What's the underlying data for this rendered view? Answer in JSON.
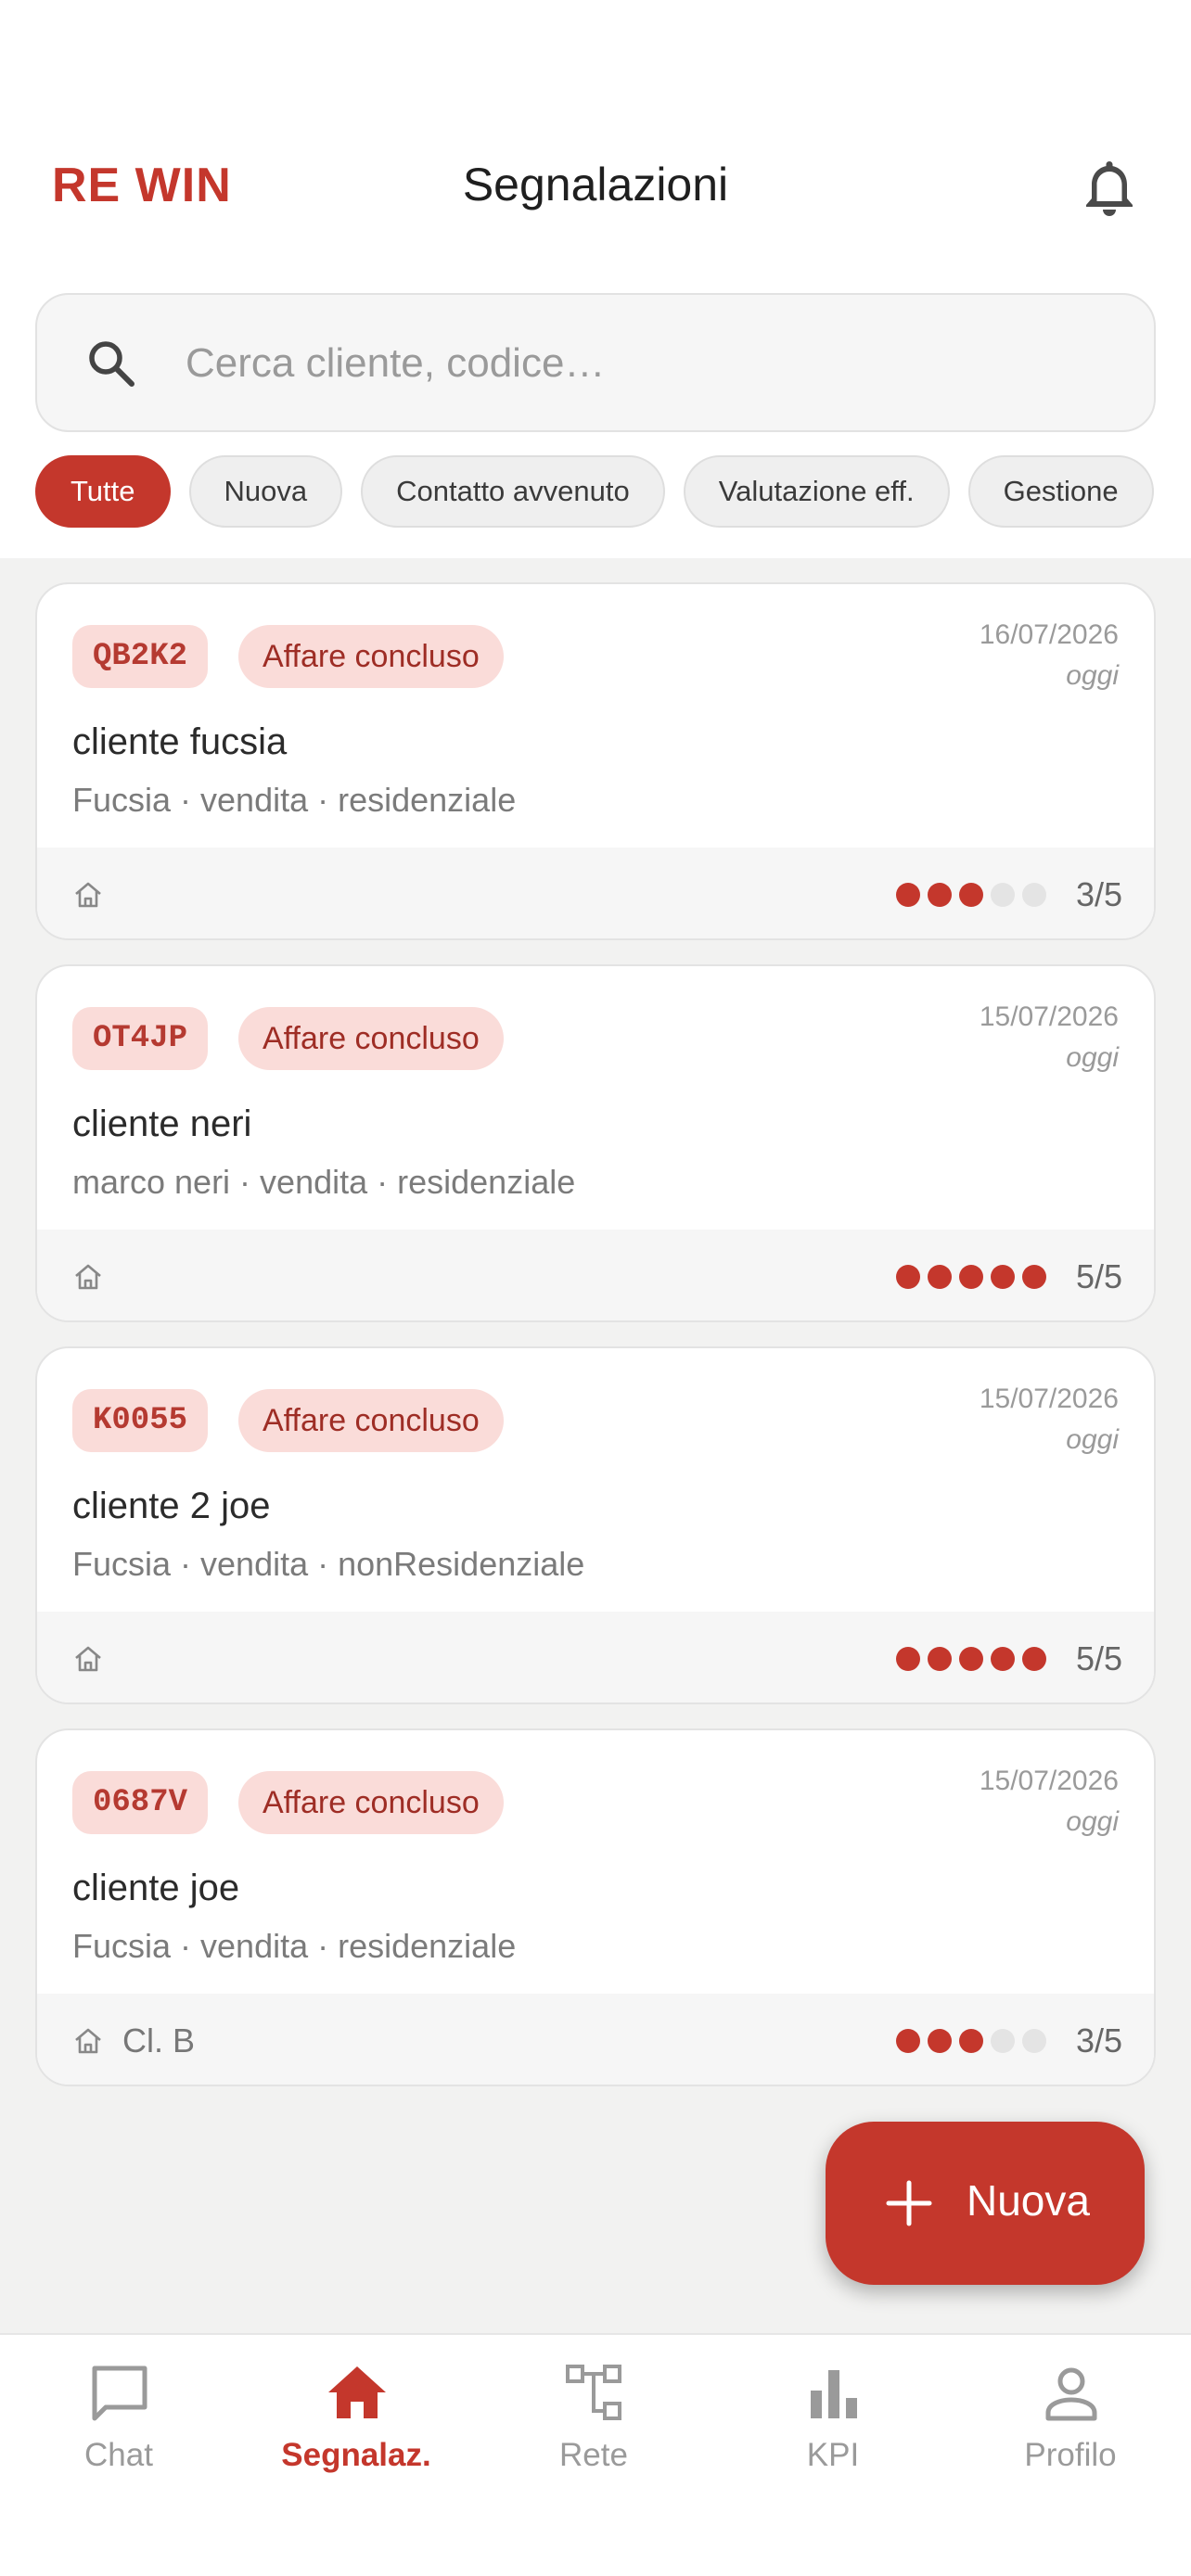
{
  "app": {
    "brand": "RE WIN",
    "title": "Segnalazioni"
  },
  "search": {
    "placeholder": "Cerca cliente, codice…"
  },
  "filters": [
    {
      "label": "Tutte",
      "active": true
    },
    {
      "label": "Nuova"
    },
    {
      "label": "Contatto avvenuto"
    },
    {
      "label": "Valutazione eff."
    },
    {
      "label": "Gestione"
    }
  ],
  "referrals": [
    {
      "code": "QB2K2",
      "status": "Affare concluso",
      "date": "16/07/2026",
      "relative": "oggi",
      "client": "cliente fucsia",
      "meta": "Fucsia · vendita · residenziale",
      "class_label": "",
      "score": 3,
      "score_max": 5,
      "score_text": "3/5"
    },
    {
      "code": "OT4JP",
      "status": "Affare concluso",
      "date": "15/07/2026",
      "relative": "oggi",
      "client": "cliente neri",
      "meta": "marco neri · vendita · residenziale",
      "class_label": "",
      "score": 5,
      "score_max": 5,
      "score_text": "5/5"
    },
    {
      "code": "K0055",
      "status": "Affare concluso",
      "date": "15/07/2026",
      "relative": "oggi",
      "client": "cliente 2 joe",
      "meta": "Fucsia · vendita · nonResidenziale",
      "class_label": "",
      "score": 5,
      "score_max": 5,
      "score_text": "5/5"
    },
    {
      "code": "0687V",
      "status": "Affare concluso",
      "date": "15/07/2026",
      "relative": "oggi",
      "client": "cliente joe",
      "meta": "Fucsia · vendita · residenziale",
      "class_label": "Cl. B",
      "score": 3,
      "score_max": 5,
      "score_text": "3/5"
    }
  ],
  "fab": {
    "label": "Nuova"
  },
  "nav": [
    {
      "label": "Chat",
      "icon": "chat-icon"
    },
    {
      "label": "Segnalaz.",
      "icon": "home-icon",
      "active": true
    },
    {
      "label": "Rete",
      "icon": "network-icon"
    },
    {
      "label": "KPI",
      "icon": "bar-chart-icon"
    },
    {
      "label": "Profilo",
      "icon": "profile-icon"
    }
  ],
  "colors": {
    "accent": "#c4372c",
    "badge_bg": "#fadcd9",
    "surface": "#f2f2f1",
    "dot_off": "#e4e4e4"
  }
}
